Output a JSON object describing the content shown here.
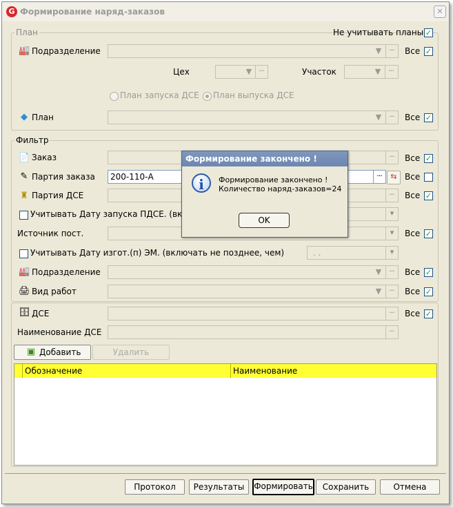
{
  "window": {
    "title": "Формирование наряд-заказов",
    "app_icon": "G"
  },
  "plan_group": {
    "caption": "План",
    "ignore_plans_label": "Не учитывать планы",
    "ignore_plans_checked": true,
    "subdivision_label": "Подразделение",
    "all_label": "Все",
    "workshop_label": "Цех",
    "section_label": "Участок",
    "radio_launch": "План запуска ДСЕ",
    "radio_release": "План выпуска ДСЕ",
    "plan_label": "План"
  },
  "filter_group": {
    "caption": "Фильтр",
    "order_label": "Заказ",
    "order_batch_label": "Партия заказа",
    "order_batch_value": "200-110-А",
    "dse_batch_label": "Партия ДСЕ",
    "launch_date_label": "Учитывать Дату запуска ПДСЕ. (вклю",
    "source_label": "Источник пост.",
    "manufacture_date_label": "Учитывать Дату изгот.(п) ЭМ. (включать не позднее, чем)",
    "date_placeholder": ". .",
    "subdivision_label": "Подразделение",
    "work_type_label": "Вид работ",
    "all_label": "Все"
  },
  "dse_section": {
    "dse_label": "ДСЕ",
    "dse_name_label": "Наименование ДСЕ",
    "all_label": "Все",
    "add_button": "Добавить",
    "delete_button": "Удалить",
    "columns": [
      "Обозначение",
      "Наименование"
    ]
  },
  "footer": {
    "protocol": "Протокол",
    "results": "Результаты",
    "form": "Формировать",
    "save": "Сохранить",
    "cancel": "Отмена"
  },
  "dialog": {
    "title": "Формирование закончено !",
    "message_line1": "Формирование закончено !",
    "message_line2": "Количество наряд-заказов=24",
    "ok": "OK"
  },
  "colors": {
    "list_header": "#ffff33",
    "dialog_title": "#6d87b1",
    "window_bg": "#ece9d8"
  }
}
